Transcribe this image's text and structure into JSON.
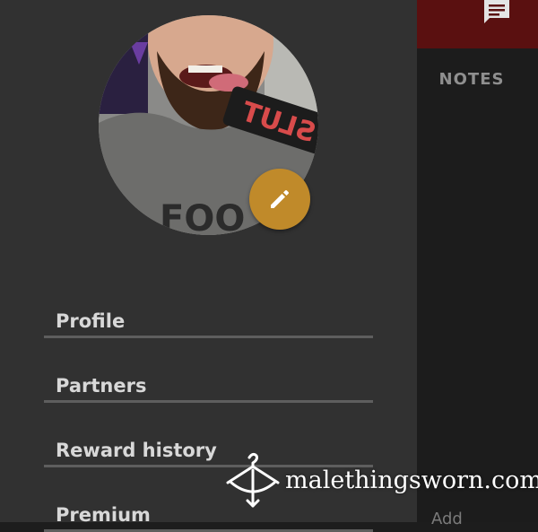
{
  "background_app": {
    "notes_tab": "NOTES",
    "add_text": "Add",
    "notes_icon": "chat-note-icon",
    "header_color": "#5a1010"
  },
  "drawer": {
    "avatar": {
      "shirt_text": "FOO",
      "sign_text": "SLUT",
      "edit_icon": "pencil-icon",
      "edit_button_color": "#c08a2a"
    },
    "menu": [
      {
        "label": "Profile"
      },
      {
        "label": "Partners"
      },
      {
        "label": "Reward history"
      },
      {
        "label": "Premium"
      }
    ]
  },
  "watermark": {
    "text": "malethingsworn.com",
    "icon": "hanger-bow-logo"
  }
}
